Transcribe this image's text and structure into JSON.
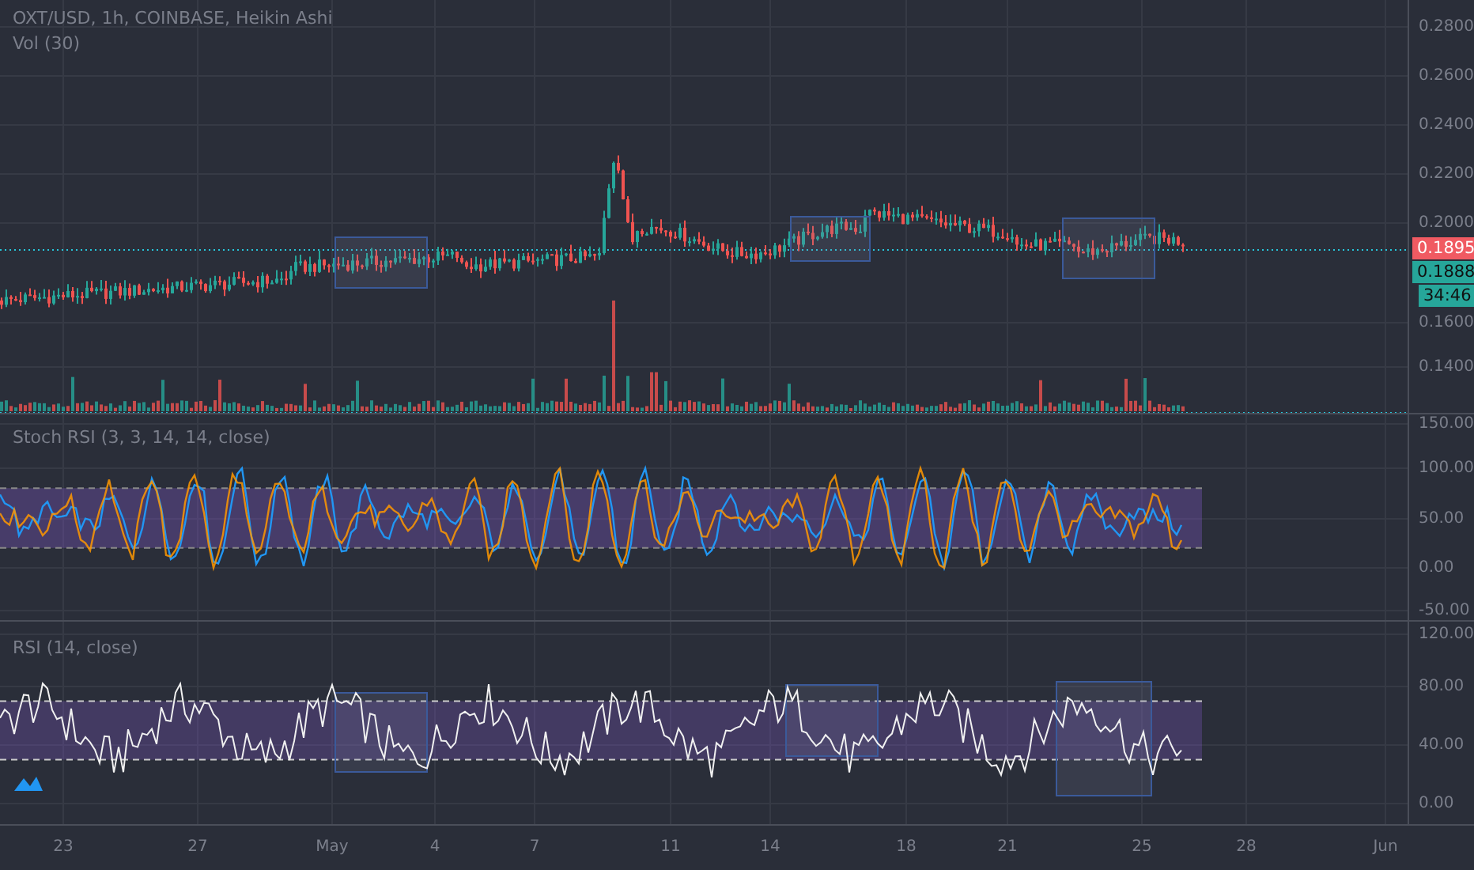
{
  "main_pane": {
    "title": "OXT/USD, 1h, COINBASE, Heikin Ashi",
    "volume_label": "Vol (30)",
    "ticks": [
      "0.2800",
      "0.2600",
      "0.2400",
      "0.2200",
      "0.2000",
      "0.1600",
      "0.1400"
    ],
    "price_tags": [
      {
        "text": "0.1895",
        "kind": "last"
      },
      {
        "text": "0.1888",
        "kind": "close"
      },
      {
        "text": "34:46",
        "kind": "countdown"
      }
    ]
  },
  "stoch_pane": {
    "title": "Stoch RSI (3, 3, 14, 14, close)",
    "ticks": [
      "150.00",
      "100.00",
      "50.00",
      "0.00",
      "-50.00"
    ]
  },
  "rsi_pane": {
    "title": "RSI (14, close)",
    "ticks": [
      "120.00",
      "80.00",
      "40.00",
      "0.00"
    ]
  },
  "time_axis": [
    "23",
    "27",
    "May",
    "4",
    "7",
    "11",
    "14",
    "18",
    "21",
    "25",
    "28",
    "Jun"
  ]
}
